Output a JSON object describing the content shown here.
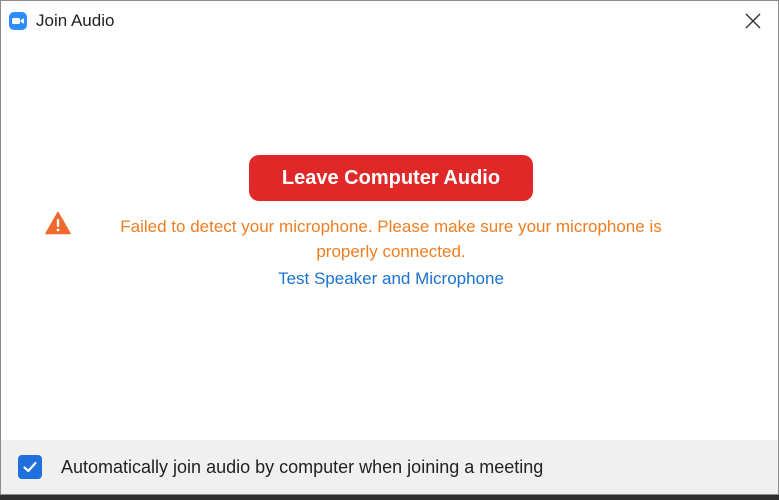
{
  "window": {
    "title": "Join Audio",
    "app_icon": "zoom-camera-icon",
    "close_icon": "close-icon"
  },
  "main": {
    "primary_button_label": "Leave Computer Audio",
    "warning_icon": "warning-triangle-icon",
    "warning_text": "Failed to detect your microphone. Please make sure your microphone is properly connected.",
    "test_link_label": "Test Speaker and Microphone"
  },
  "footer": {
    "checkbox_checked": true,
    "checkbox_label": "Automatically join audio by computer when joining a meeting"
  },
  "colors": {
    "primary_button": "#e02828",
    "warning": "#ef7d22",
    "link": "#1a73d1",
    "checkbox": "#1f6fdc",
    "app_icon": "#2d8cff"
  }
}
